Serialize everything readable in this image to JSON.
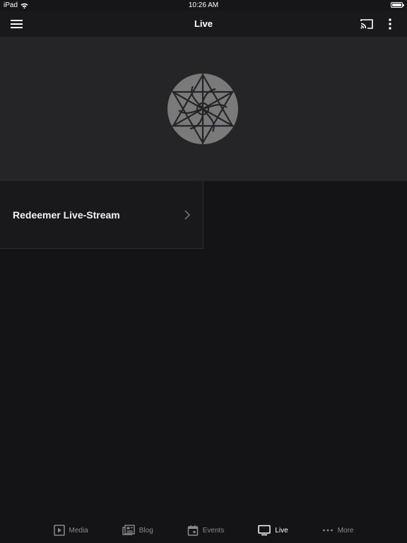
{
  "status_bar": {
    "device": "iPad",
    "time": "10:26 AM"
  },
  "header": {
    "title": "Live"
  },
  "stream_item": {
    "title": "Redeemer Live-Stream"
  },
  "tabs": [
    {
      "label": "Media",
      "icon": "play-square-icon"
    },
    {
      "label": "Blog",
      "icon": "newspaper-icon"
    },
    {
      "label": "Events",
      "icon": "calendar-icon"
    },
    {
      "label": "Live",
      "icon": "tv-icon",
      "active": true
    },
    {
      "label": "More",
      "icon": "ellipsis-icon"
    }
  ],
  "colors": {
    "background": "#141416",
    "hero": "#252527",
    "logo": "#7a7a7a",
    "inactive_tab": "#8a8a8c"
  }
}
